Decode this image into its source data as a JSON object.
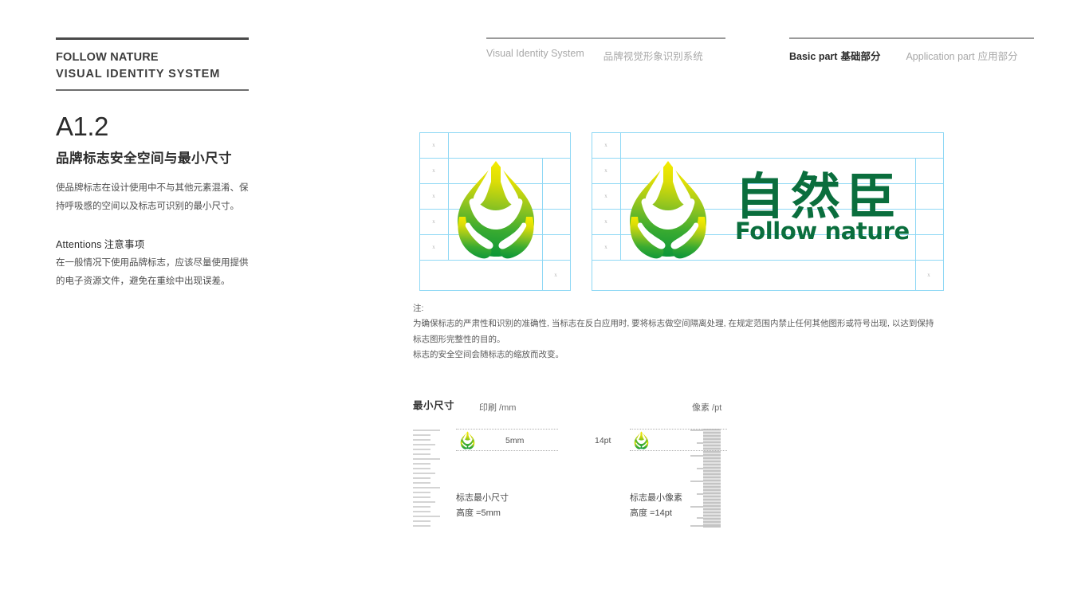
{
  "brand": {
    "line1": "FOLLOW NATURE",
    "line2": "VISUAL IDENTITY SYSTEM"
  },
  "header": {
    "left_nav": [
      {
        "en": "Visual Identity System",
        "cn": "",
        "active": false
      },
      {
        "en": "",
        "cn": "品牌视觉形象识别系统",
        "active": false
      }
    ],
    "right_nav": [
      {
        "en": "Basic part",
        "cn": "基础部分",
        "active": true
      },
      {
        "en": "Application part",
        "cn": "应用部分",
        "active": false
      }
    ]
  },
  "section": {
    "code": "A1.2",
    "title": "品牌标志安全空间与最小尺寸",
    "body": "使品牌标志在设计使用中不与其他元素混淆、保持呼吸感的空间以及标志可识别的最小尺寸。",
    "attentions_title_en": "Attentions",
    "attentions_title_cn": "注意事项",
    "attentions_body": "在一般情况下使用品牌标志，应该尽量使用提供的电子资源文件，避免在重绘中出现误差。"
  },
  "clearspace": {
    "x_marker": "x",
    "panel_a_x_count": 6,
    "panel_b_x_count": 6
  },
  "notes": {
    "label": "注:",
    "line1": "为确保标志的严肃性和识别的准确性, 当标志在反白应用时, 要将标志做空间隔离处理, 在规定范围内禁止任何其他图形或符号出现, 以达到保持",
    "line2": "标志图形完整性的目的。",
    "line3": "标志的安全空间会随标志的缩放而改变。"
  },
  "minsize": {
    "heading": "最小尺寸",
    "print_label": "印刷 /mm",
    "pixel_label": "像素 /pt",
    "print": {
      "value": "5mm",
      "caption_line1": "标志最小尺寸",
      "caption_line2": "高度 =5mm"
    },
    "pixel": {
      "value": "14pt",
      "caption_line1": "标志最小像素",
      "caption_line2": "高度 =14pt"
    }
  },
  "logo": {
    "wordmark_cn": "自然臣",
    "wordmark_en": "Follow nature",
    "colors": {
      "gradient_top": "#f2e600",
      "gradient_mid": "#8cc31f",
      "gradient_bottom": "#0f9b3c",
      "wordmark": "#0a6e3d",
      "guide_line": "#8fd8f5"
    }
  }
}
